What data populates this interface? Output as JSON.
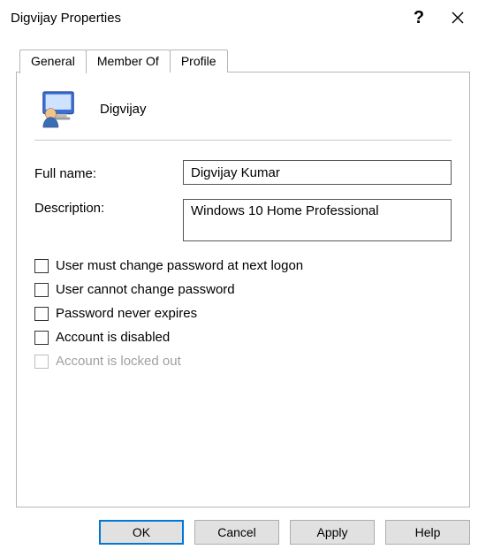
{
  "window": {
    "title": "Digvijay Properties"
  },
  "tabs": {
    "general": "General",
    "member_of": "Member Of",
    "profile": "Profile"
  },
  "identity": {
    "username": "Digvijay"
  },
  "fields": {
    "full_name_label": "Full name:",
    "full_name_value": "Digvijay Kumar",
    "description_label": "Description:",
    "description_value": "Windows 10 Home Professional"
  },
  "checks": {
    "must_change": "User must change password at next logon",
    "cannot_change": "User cannot change password",
    "never_expires": "Password never expires",
    "disabled": "Account is disabled",
    "locked_out": "Account is locked out"
  },
  "buttons": {
    "ok": "OK",
    "cancel": "Cancel",
    "apply": "Apply",
    "help": "Help"
  }
}
